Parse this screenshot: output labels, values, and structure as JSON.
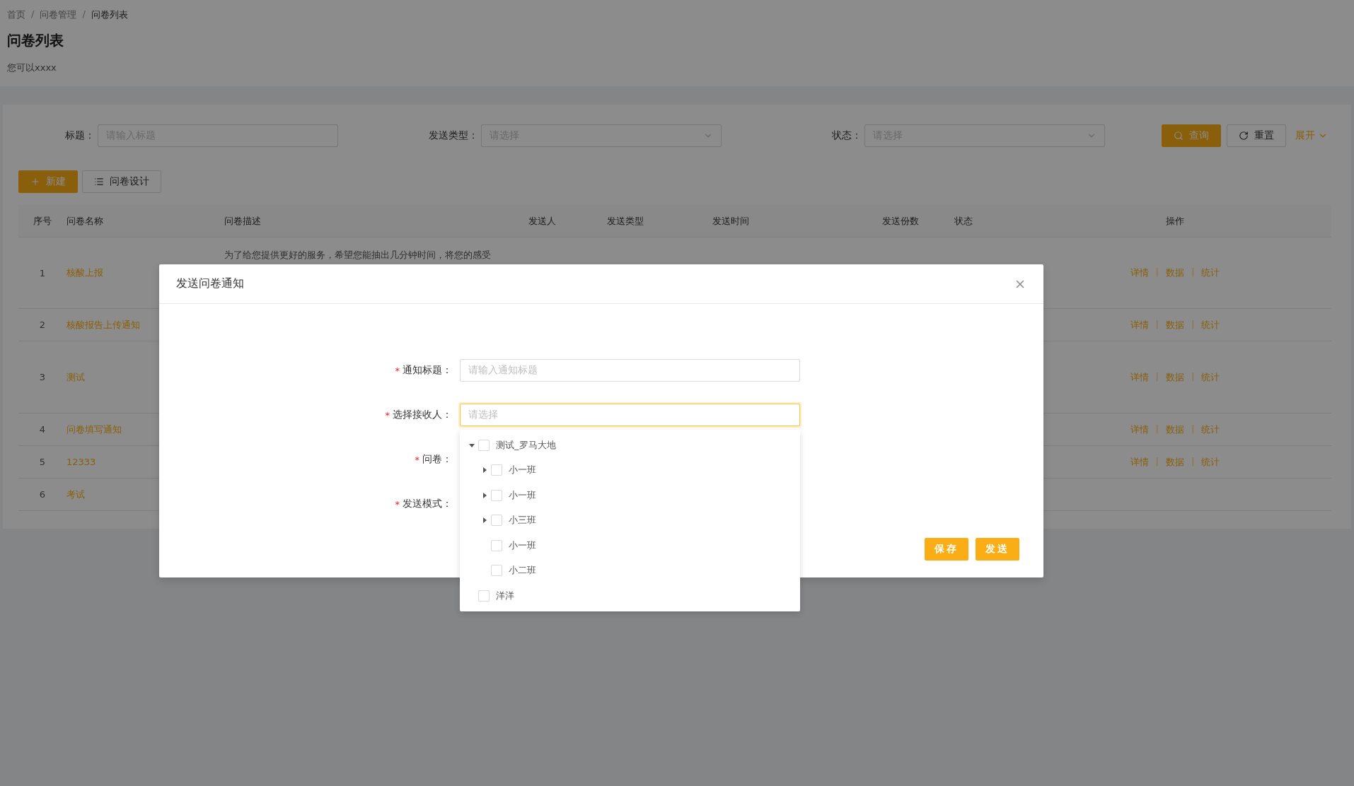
{
  "breadcrumb": {
    "separator": "/",
    "items": [
      "首页",
      "问卷管理",
      "问卷列表"
    ]
  },
  "page": {
    "title": "问卷列表",
    "subtitle": "您可以xxxx"
  },
  "filters": [
    {
      "kind": "input",
      "label": "标题：",
      "placeholder": "请输入标题"
    },
    {
      "kind": "select",
      "label": "发送类型：",
      "placeholder": "请选择"
    },
    {
      "kind": "select",
      "label": "状态：",
      "placeholder": "请选择"
    }
  ],
  "filter_actions": [
    {
      "kind": "primary",
      "label": "查询"
    },
    {
      "kind": "default",
      "label": "重置"
    },
    {
      "kind": "link",
      "label": "展开"
    }
  ],
  "toolbar": [
    {
      "kind": "primary",
      "label": "新建"
    },
    {
      "kind": "default",
      "label": "问卷设计"
    }
  ],
  "table": {
    "columns": [
      "序号",
      "问卷名称",
      "问卷描述",
      "发送人",
      "发送类型",
      "发送时间",
      "发送份数",
      "状态",
      "操作"
    ],
    "action_separator": "|",
    "rows": [
      {
        "index": "1",
        "name": "核酸上报",
        "description": "为了给您提供更好的服务，希望您能抽出几分钟时间，将您的感受",
        "actions": [
          "详情",
          "数据",
          "统计"
        ]
      },
      {
        "index": "2",
        "name": "核酸报告上传通知",
        "actions": [
          "详情",
          "数据",
          "统计"
        ]
      },
      {
        "index": "3",
        "name": "测试",
        "actions": [
          "详情",
          "数据",
          "统计"
        ]
      },
      {
        "index": "4",
        "name": "问卷填写通知",
        "actions": [
          "详情",
          "数据",
          "统计"
        ]
      },
      {
        "index": "5",
        "name": "12333",
        "actions": [
          "详情",
          "数据",
          "统计"
        ]
      },
      {
        "index": "6",
        "name": "考试"
      }
    ]
  },
  "modal": {
    "title": "发送问卷通知",
    "required_mark": "*",
    "fields": [
      {
        "kind": "input",
        "label": "通知标题：",
        "required": true,
        "placeholder": "请输入通知标题",
        "focused": false
      },
      {
        "kind": "tree-select",
        "label": "选择接收人：",
        "required": true,
        "placeholder": "请选择",
        "focused": true
      },
      {
        "kind": "hidden",
        "label": "问卷：",
        "required": true
      },
      {
        "kind": "hidden",
        "label": "发送模式：",
        "required": true
      }
    ],
    "buttons": [
      "保存",
      "发送"
    ],
    "tree": [
      {
        "label": "测试_罗马大地",
        "checked": false,
        "expanded": true,
        "children": [
          {
            "label": "小一班",
            "checked": false,
            "expanded": false
          },
          {
            "label": "小一班",
            "checked": false,
            "expanded": false
          },
          {
            "label": "小三班",
            "checked": false,
            "expanded": false
          },
          {
            "label": "小一班",
            "checked": false
          },
          {
            "label": "小二班",
            "checked": false
          }
        ]
      },
      {
        "label": "洋洋",
        "checked": false
      }
    ]
  }
}
